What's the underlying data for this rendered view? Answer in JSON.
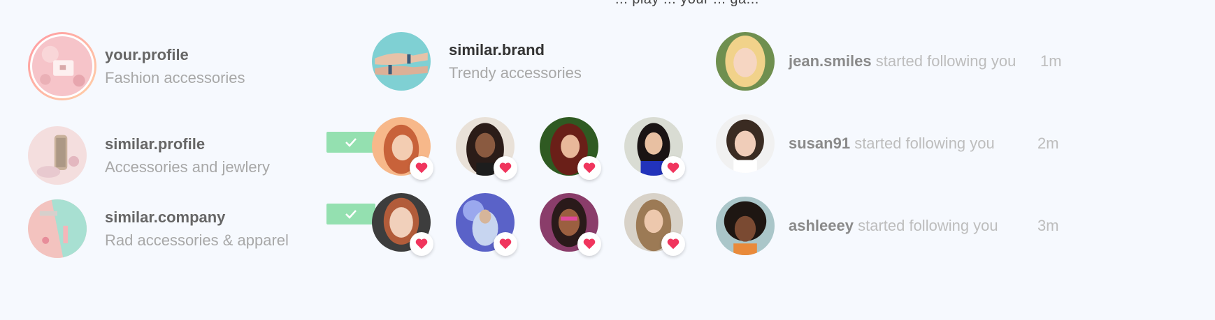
{
  "top_cut_text": "... play ... your ... ga...",
  "profiles": [
    {
      "name": "your.profile",
      "subtitle": "Fashion accessories"
    },
    {
      "name": "similar.profile",
      "subtitle": "Accessories and jewlery"
    },
    {
      "name": "similar.company",
      "subtitle": "Rad accessories & apparel"
    }
  ],
  "brand": {
    "name": "similar.brand",
    "subtitle": "Trendy accessories"
  },
  "activity": [
    {
      "user": "jean.smiles",
      "action": "started following you",
      "time": "1m"
    },
    {
      "user": "susan91",
      "action": "started following you",
      "time": "2m"
    },
    {
      "user": "ashleeey",
      "action": "started following you",
      "time": "3m"
    }
  ],
  "colors": {
    "background": "#f6f9fe",
    "check": "#94e0b0",
    "heart": "#f0355d"
  },
  "icons": {
    "check": "check-icon",
    "heart": "heart-icon"
  }
}
